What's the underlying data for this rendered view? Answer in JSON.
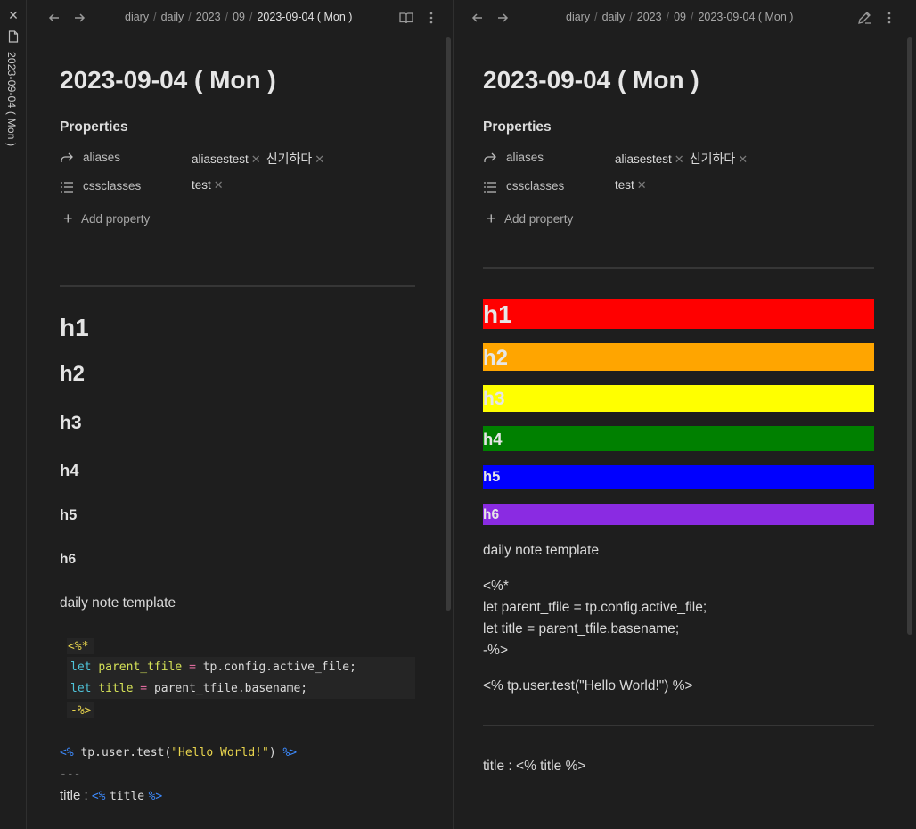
{
  "sidebar": {
    "close_glyph": "✕",
    "file_title": "2023-09-04 ( Mon )"
  },
  "left": {
    "breadcrumb": [
      "diary",
      "daily",
      "2023",
      "09",
      "2023-09-04 ( Mon )"
    ],
    "title": "2023-09-04 ( Mon )",
    "properties_heading": "Properties",
    "properties": [
      {
        "name": "aliases",
        "icon": "link-arrow-icon",
        "values": [
          "aliasestest",
          "신기하다"
        ]
      },
      {
        "name": "cssclasses",
        "icon": "list-icon",
        "values": [
          "test"
        ]
      }
    ],
    "add_property": "Add property",
    "headings": [
      "h1",
      "h2",
      "h3",
      "h4",
      "h5",
      "h6"
    ],
    "paragraph": "daily note template",
    "code": {
      "open": "<%*",
      "line1": {
        "kw": "let",
        "var": "parent_tfile",
        "op": "=",
        "rest": "tp.config.active_file;"
      },
      "line2": {
        "kw": "let",
        "var": "title",
        "op": "=",
        "rest": "parent_tfile.basename;"
      },
      "close": "-%>"
    },
    "tp_line": {
      "open": "<%",
      "call": "tp.user.test(",
      "str": "\"Hello World!\"",
      "close_paren": ")",
      "close": "%>"
    },
    "dashes": "---",
    "title_line": {
      "label": "title : ",
      "open": "<%",
      "var": "title",
      "close": "%>"
    }
  },
  "right": {
    "breadcrumb": [
      "diary",
      "daily",
      "2023",
      "09",
      "2023-09-04 ( Mon )"
    ],
    "title": "2023-09-04 ( Mon )",
    "properties_heading": "Properties",
    "properties": [
      {
        "name": "aliases",
        "icon": "link-arrow-icon",
        "values": [
          "aliasestest",
          "신기하다"
        ]
      },
      {
        "name": "cssclasses",
        "icon": "list-icon",
        "values": [
          "test"
        ]
      }
    ],
    "add_property": "Add property",
    "headings": [
      {
        "text": "h1",
        "color": "#ff0000"
      },
      {
        "text": "h2",
        "color": "#ffa500"
      },
      {
        "text": "h3",
        "color": "#ffff00"
      },
      {
        "text": "h4",
        "color": "#008000"
      },
      {
        "text": "h5",
        "color": "#0000ff"
      },
      {
        "text": "h6",
        "color": "#8a2be2"
      }
    ],
    "paragraph": "daily note template",
    "raw_lines": [
      "<%*",
      "let parent_tfile = tp.config.active_file;",
      "let title = parent_tfile.basename;",
      "-%>"
    ],
    "tp_line": "<% tp.user.test(\"Hello World!\") %>",
    "title_line": "title : <% title %>"
  },
  "icons": {
    "back": "arrow-left-icon",
    "forward": "arrow-right-icon",
    "reading": "book-open-icon",
    "edit": "pencil-icon",
    "more": "more-vertical-icon"
  }
}
